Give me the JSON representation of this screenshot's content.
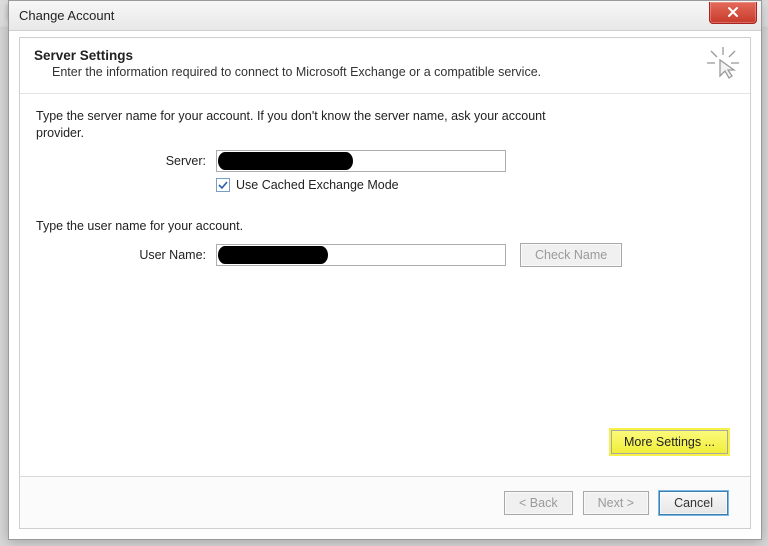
{
  "window": {
    "title": "Change Account"
  },
  "header": {
    "title": "Server Settings",
    "subtitle": "Enter the information required to connect to Microsoft Exchange or a compatible service."
  },
  "server_section": {
    "intro": "Type the server name for your account. If you don't know the server name, ask your account provider.",
    "server_label": "Server:",
    "server_value": "",
    "cached_mode_checked": true,
    "cached_mode_label": "Use Cached Exchange Mode"
  },
  "user_section": {
    "intro": "Type the user name for your account.",
    "user_label": "User Name:",
    "user_value": "",
    "check_name_label": "Check Name"
  },
  "buttons": {
    "more_settings": "More Settings ...",
    "back": "< Back",
    "next": "Next >",
    "cancel": "Cancel"
  }
}
